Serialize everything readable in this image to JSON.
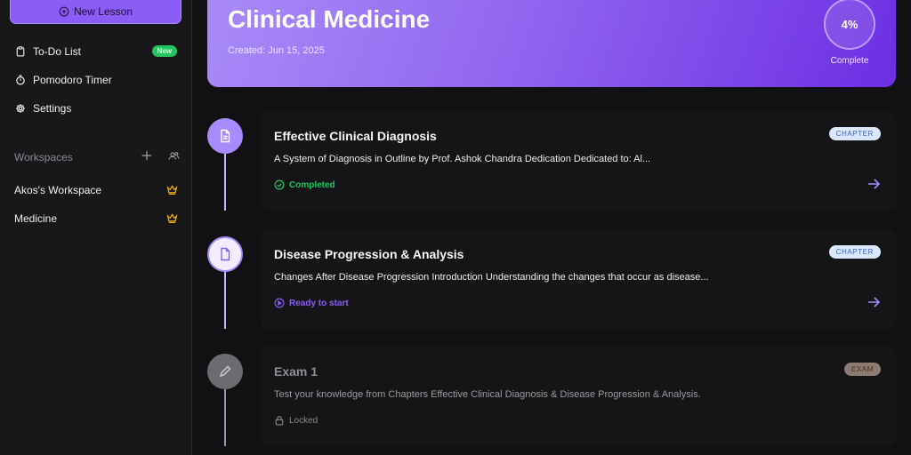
{
  "sidebar": {
    "new_lesson_label": "New Lesson",
    "nav": [
      {
        "label": "To-Do List",
        "icon": "clipboard-icon",
        "badge": "New"
      },
      {
        "label": "Pomodoro Timer",
        "icon": "timer-icon"
      },
      {
        "label": "Settings",
        "icon": "gear-icon"
      }
    ],
    "workspaces_label": "Workspaces",
    "workspaces": [
      {
        "label": "Akos's Workspace",
        "icon": "crown-icon"
      },
      {
        "label": "Medicine",
        "icon": "crown-icon"
      }
    ]
  },
  "course": {
    "title": "Clinical Medicine",
    "created": "Created: Jun 15, 2025",
    "progress": "4%",
    "progress_label": "Complete"
  },
  "lessons": [
    {
      "title": "Effective Clinical Diagnosis",
      "description": "A System of Diagnosis in Outline by Prof. Ashok Chandra Dedication Dedicated to: Al...",
      "tag": "CHAPTER",
      "status": "Completed"
    },
    {
      "title": "Disease Progression & Analysis",
      "description": "Changes After Disease Progression Introduction Understanding the changes that occur as disease...",
      "tag": "CHAPTER",
      "status": "Ready to start"
    },
    {
      "title": "Exam 1",
      "description": "Test your knowledge from Chapters Effective Clinical Diagnosis & Disease Progression & Analysis.",
      "tag": "EXAM",
      "status": "Locked"
    }
  ],
  "colors": {
    "accent": "#8b5cf6",
    "completed": "#22c55e",
    "chapter_tag_bg": "#dbe7fb",
    "exam_tag_bg": "#8c7b70"
  }
}
